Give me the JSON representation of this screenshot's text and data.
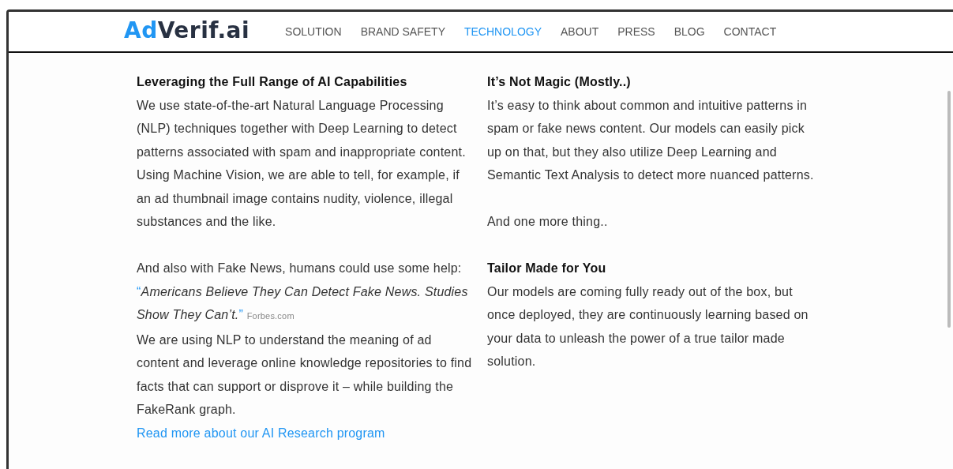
{
  "logo": {
    "part_1": "Ad",
    "part_2": "Verif.ai"
  },
  "nav": [
    {
      "label": "SOLUTION",
      "selected": false
    },
    {
      "label": "BRAND SAFETY",
      "selected": false
    },
    {
      "label": "TECHNOLOGY",
      "selected": true
    },
    {
      "label": "ABOUT",
      "selected": false
    },
    {
      "label": "PRESS",
      "selected": false
    },
    {
      "label": "BLOG",
      "selected": false
    },
    {
      "label": "CONTACT",
      "selected": false
    }
  ],
  "columns": [
    {
      "blocks": [
        {
          "kind": "heading",
          "text": "Leveraging the Full Range of AI Capabilities"
        },
        {
          "kind": "paragraph",
          "text": "We use state-of-the-art Natural Language Processing (NLP) techniques together with Deep Learning to detect patterns associated with spam and inappropriate content. Using Machine Vision, we are able to tell, for example, if an ad thumbnail image contains nudity, violence, illegal substances and the like."
        },
        {
          "kind": "spacer"
        },
        {
          "kind": "paragraph",
          "text": "And also with Fake News, humans could use some help:"
        },
        {
          "kind": "quote",
          "open": "“",
          "text": "Americans Believe They Can Detect Fake News. Studies Show They Can’t.",
          "close": "”",
          "source": "Forbes.com"
        },
        {
          "kind": "paragraph",
          "text": "We are using NLP to understand the meaning of ad content and leverage online knowledge repositories to find facts that can support or disprove it – while building the FakeRank graph."
        },
        {
          "kind": "link",
          "text": "Read more about our AI Research program"
        }
      ]
    },
    {
      "blocks": [
        {
          "kind": "heading",
          "text": "It’s Not Magic (Mostly..)"
        },
        {
          "kind": "paragraph",
          "text": "It’s easy to think about common and intuitive patterns in spam or fake news content. Our models can easily pick up on that, but they also utilize Deep Learning and Semantic Text Analysis to detect more nuanced patterns."
        },
        {
          "kind": "spacer"
        },
        {
          "kind": "paragraph",
          "text": "And one more thing.."
        },
        {
          "kind": "spacer"
        },
        {
          "kind": "heading",
          "text": "Tailor Made for You"
        },
        {
          "kind": "paragraph",
          "text": "Our models are coming fully ready out of the box, but once deployed, they are continuously learning based on your data to unleash the power of a true tailor made solution."
        }
      ]
    }
  ]
}
